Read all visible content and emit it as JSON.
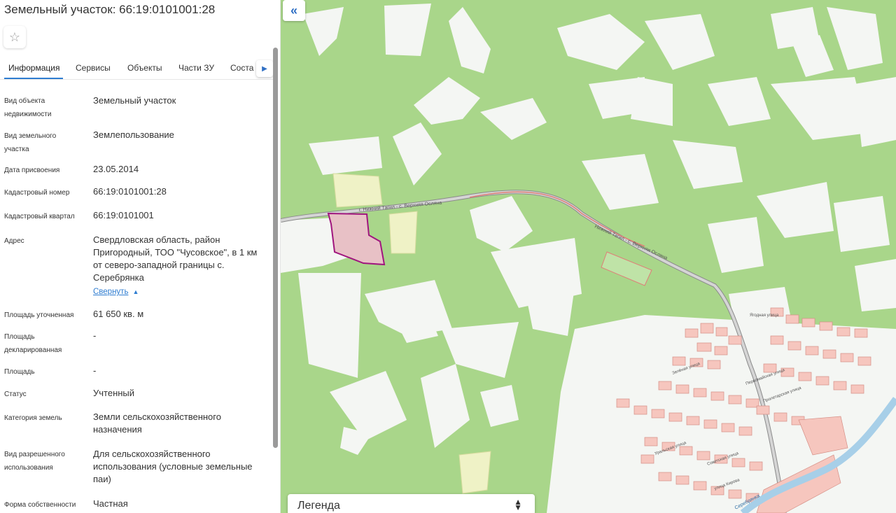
{
  "title": "Земельный участок: 66:19:0101001:28",
  "tabs": [
    {
      "label": "Информация"
    },
    {
      "label": "Сервисы"
    },
    {
      "label": "Объекты"
    },
    {
      "label": "Части ЗУ"
    },
    {
      "label": "Соста"
    }
  ],
  "fields": [
    {
      "label": "Вид объекта недвижимости",
      "value": "Земельный участок"
    },
    {
      "label": "Вид земельного участка",
      "value": "Землепользование"
    },
    {
      "label": "Дата присвоения",
      "value": "23.05.2014"
    },
    {
      "label": "Кадастровый номер",
      "value": "66:19:0101001:28"
    },
    {
      "label": "Кадастровый квартал",
      "value": "66:19:0101001"
    },
    {
      "label": "Адрес",
      "value": "Свердловская область, район Пригородный, ТОО \"Чусовское\", в 1 км от северо-западной границы с. Серебрянка"
    },
    {
      "label": "Площадь уточненная",
      "value": "61 650 кв. м"
    },
    {
      "label": "Площадь декларированная",
      "value": "-"
    },
    {
      "label": "Площадь",
      "value": "-"
    },
    {
      "label": "Статус",
      "value": "Учтенный"
    },
    {
      "label": "Категория земель",
      "value": "Земли сельскохозяйственного назначения"
    },
    {
      "label": "Вид разрешенного использования",
      "value": "Для сельскохозяйственного использования (условные земельные паи)"
    },
    {
      "label": "Форма собственности",
      "value": "Частная"
    }
  ],
  "collapse_link": "Свернуть",
  "map": {
    "road_label_1": "г. Нижний Тагил - с. Верхняя Осляна",
    "road_label_2": "Нижний Тагил - с. Верхняя Осляна",
    "streets": [
      "Ягодная улица",
      "Зелёная улица",
      "Первомайская улица",
      "Пролетарская улица",
      "Уральская улица",
      "Советская улица",
      "улица Кирова"
    ],
    "river": "Серебрянка",
    "colors": {
      "forest": "#a9d68a",
      "clearing": "#f4f6f3",
      "parcel_fill": "#e8c1c6",
      "parcel_stroke": "#a0167e",
      "field": "#f0f1c8",
      "building": "#f6c6be"
    }
  },
  "legend": {
    "label": "Легенда"
  }
}
